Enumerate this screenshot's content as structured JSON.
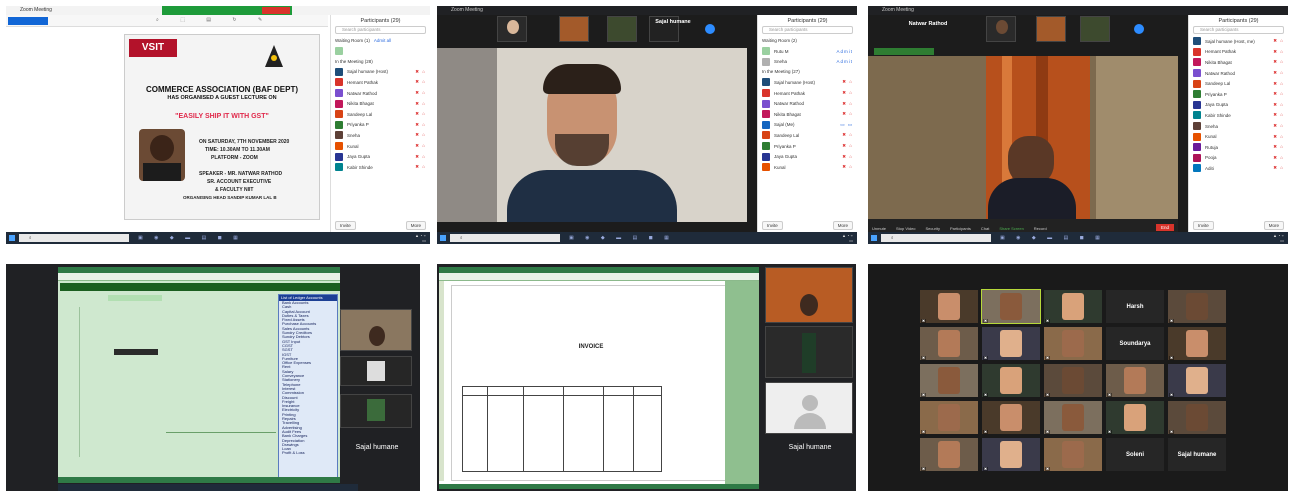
{
  "screen1": {
    "window_title": "Zoom Meeting",
    "poster": {
      "logo": "VSIT",
      "headline": "COMMERCE ASSOCIATION (BAF DEPT)",
      "sub": "HAS ORGANISED A GUEST LECTURE ON",
      "topic": "\"EASILY SHIP IT WITH GST\"",
      "when": "ON SATURDAY, 7TH NOVEMBER 2020",
      "time": "TIME: 10.30AM TO 11.30AM",
      "platform": "PLATFORM - ZOOM",
      "speaker": "SPEAKER - MR. NATWAR RATHOD",
      "role1": "SR. ACCOUNT EXECUTIVE",
      "role2": "& FACULTY NIIT",
      "organiser": "ORGANISING HEAD SANDIP KUMAR LAL B"
    },
    "panel_title": "Participants (29)",
    "search_placeholder": "Search participants",
    "waiting_label": "Waiting Room (1)",
    "admit_all": "Admit all",
    "in_meeting_label": "In the Meeting (28)",
    "participants": [
      "Sajal humane (Host)",
      "Hemant Pathak",
      "Natwar Rathod",
      "Nikita Bhagat",
      "Sandeep Lal",
      "Priyanka P",
      "Sneha",
      "Kunal",
      "Jaya Gupta",
      "Kabir Shinde"
    ],
    "invite": "Invite",
    "more": "More"
  },
  "screen2": {
    "window_title": "Zoom Meeting",
    "speaker_name": "Sajal humane",
    "panel_title": "Participants (29)",
    "search_placeholder": "Search participants",
    "waiting_label": "Waiting Room (2)",
    "in_meeting_label": "In the Meeting (27)",
    "participants": [
      "Rutu M",
      "Sneha",
      "Sajal humane (Host)",
      "Hemant Pathak",
      "Natwar Rathod",
      "Nikita Bhagat",
      "Sajal (Me)",
      "Sandeep Lal",
      "Priyanka P",
      "Jaya Gupta",
      "Kunal"
    ],
    "admit": "Admit",
    "invite": "Invite",
    "more": "More"
  },
  "screen3": {
    "window_title": "Zoom Meeting",
    "speaker_name": "Natwar Rathod",
    "panel_title": "Participants (29)",
    "search_placeholder": "Search participants",
    "participants": [
      "Sajal humane (Host, me)",
      "Hemant Pathak",
      "Nikita Bhagat",
      "Natwar Rathod",
      "Sandeep Lal",
      "Priyanka P",
      "Jaya Gupta",
      "Kabir Shinde",
      "Sneha",
      "Kunal",
      "Rutuja",
      "Pooja",
      "Aditi"
    ],
    "controls": [
      "Unmute",
      "Stop Video",
      "Security",
      "Participants",
      "Chat",
      "Share Screen",
      "Record",
      "Reactions"
    ],
    "leave": "End",
    "invite": "Invite",
    "more": "More"
  },
  "screen4": {
    "app": "Tally",
    "company": "Gateway of Tally",
    "voucher": "Accounting Voucher Creation",
    "list_title": "List of Ledger Accounts",
    "ledgers": [
      "Bank Accounts",
      "Cash",
      "Capital Account",
      "Duties & Taxes",
      "Fixed Assets",
      "Purchase Accounts",
      "Sales Accounts",
      "Sundry Creditors",
      "Sundry Debtors",
      "GST Input",
      "CGST",
      "SGST",
      "IGST",
      "Furniture",
      "Office Expenses",
      "Rent",
      "Salary",
      "Conveyance",
      "Stationery",
      "Telephone",
      "Interest",
      "Commission",
      "Discount",
      "Freight",
      "Insurance",
      "Electricity",
      "Printing",
      "Repairs",
      "Travelling",
      "Advertising",
      "Audit Fees",
      "Bank Charges",
      "Depreciation",
      "Drawings",
      "Loan",
      "Profit & Loss"
    ],
    "participant_name": "Sajal humane"
  },
  "screen5": {
    "app": "Tally",
    "invoice_title": "INVOICE",
    "participant_name": "Sajal humane"
  },
  "screen6": {
    "names": [
      "Harsh",
      "Soundarya",
      "Soleni",
      "Sajal humane"
    ]
  }
}
